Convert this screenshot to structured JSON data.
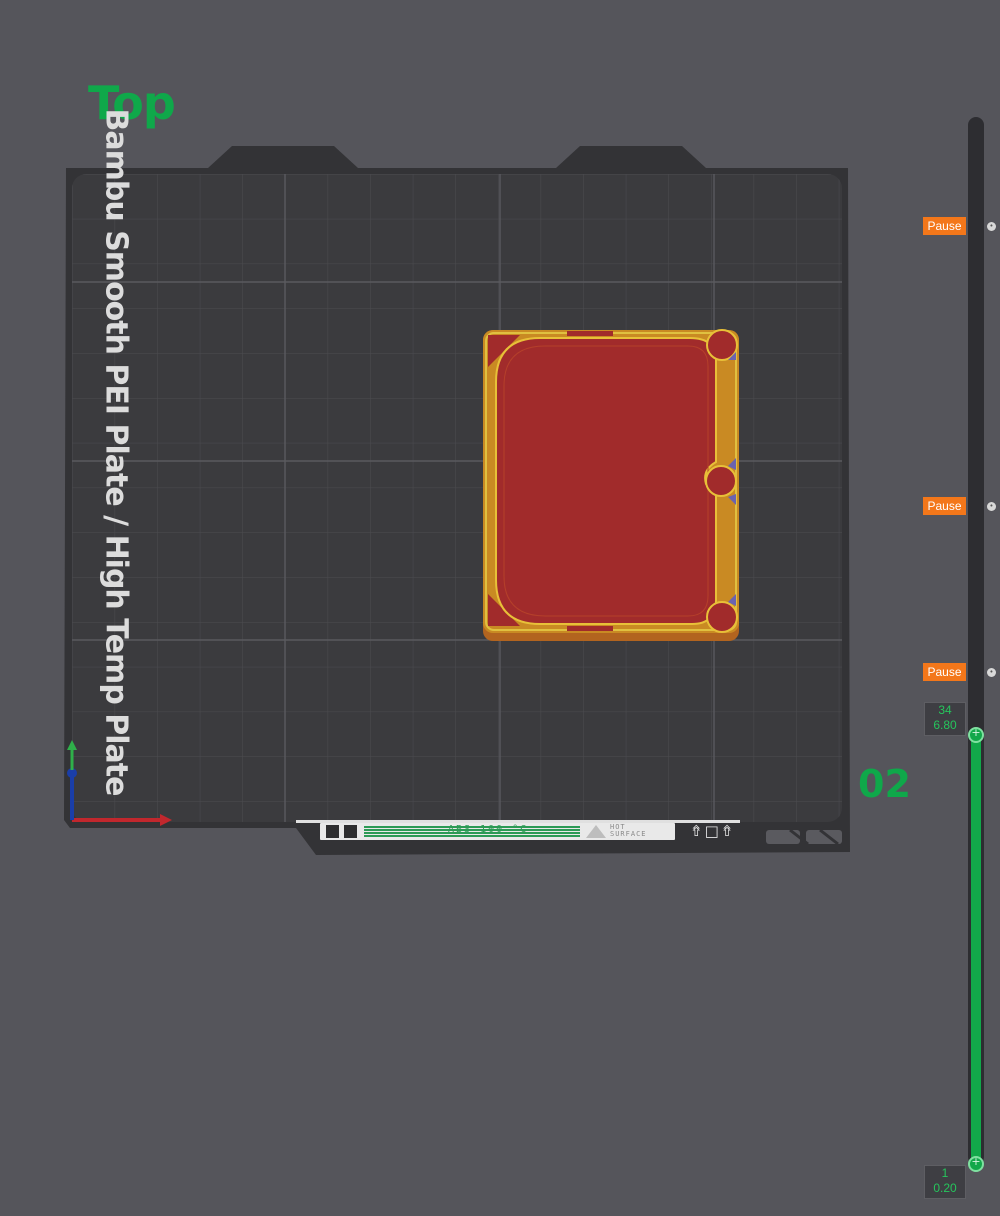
{
  "viewport": {
    "view_label": "Top",
    "plate_number": "02",
    "plate_name": "Bambu Smooth PEI Plate / High Temp Plate"
  },
  "plate_strip": {
    "material_text": "ABS 100 °C",
    "hot_surface_line1": "HOT",
    "hot_surface_line2": "SURFACE",
    "icons": "⇮□⇮"
  },
  "layer_slider": {
    "top_layer": "34",
    "top_height": "6.80",
    "bottom_layer": "1",
    "bottom_height": "0.20",
    "pause_labels": [
      "Pause",
      "Pause",
      "Pause"
    ]
  },
  "colors": {
    "accent_green": "#12a84a",
    "pause_orange": "#f3771a",
    "model_fill": "#a12b2b",
    "model_wall": "#c07a22",
    "bed": "#3b3b3e"
  }
}
